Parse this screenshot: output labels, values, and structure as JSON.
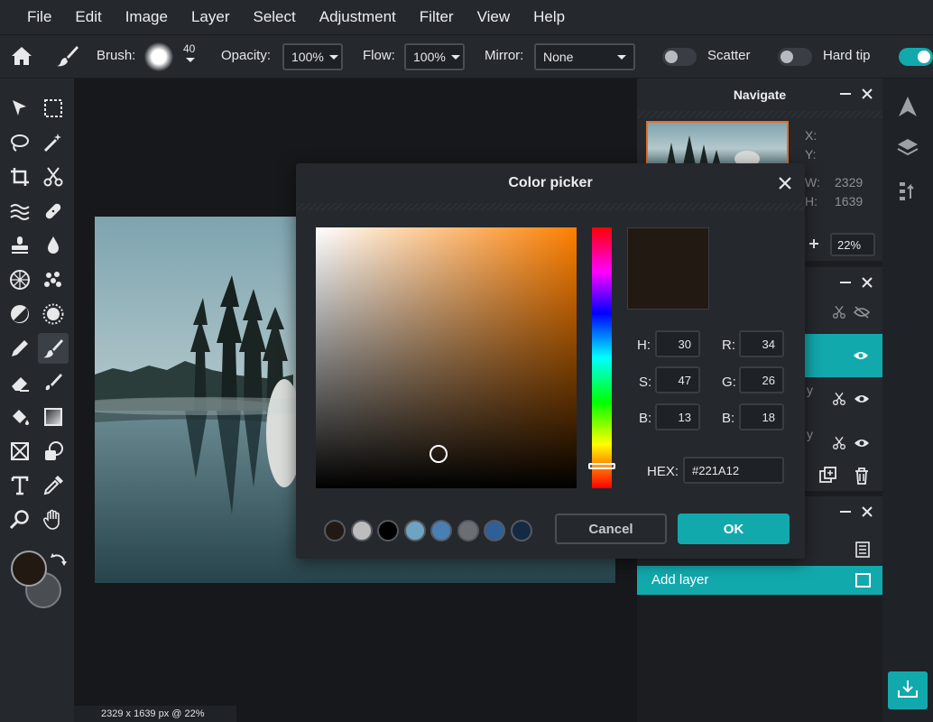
{
  "menu": [
    "File",
    "Edit",
    "Image",
    "Layer",
    "Select",
    "Adjustment",
    "Filter",
    "View",
    "Help"
  ],
  "options": {
    "brush_label": "Brush:",
    "brush_size": "40",
    "opacity_label": "Opacity:",
    "opacity_value": "100%",
    "flow_label": "Flow:",
    "flow_value": "100%",
    "mirror_label": "Mirror:",
    "mirror_value": "None",
    "scatter_label": "Scatter",
    "scatter_on": false,
    "hardtip_label": "Hard tip",
    "hardtip_on": false,
    "last_toggle_on": true
  },
  "tools": [
    "select-arrow",
    "marquee",
    "lasso",
    "magic-wand",
    "crop",
    "scissors",
    "liquify",
    "healing-bandage",
    "clone-stamp",
    "blur-drop",
    "sponge-dots",
    "dots-cluster",
    "dodge",
    "burn-sun",
    "pencil",
    "brush",
    "eraser",
    "smudge",
    "paint-bucket",
    "gradient",
    "frame-box",
    "shape",
    "text",
    "eyedropper",
    "zoom",
    "hand"
  ],
  "colors": {
    "primary": "#221A12",
    "secondary": "#4a4d52",
    "accent": "#12a9ad"
  },
  "canvas": {
    "status": "2329 x 1639 px @ 22%"
  },
  "navigate": {
    "title": "Navigate",
    "x_label": "X:",
    "y_label": "Y:",
    "w_label": "W:",
    "w_value": "2329",
    "h_label": "H:",
    "h_value": "1639",
    "zoom": "22%"
  },
  "layers": {
    "add_layer": "Add layer",
    "row_fragment": "y"
  },
  "picker": {
    "title": "Color picker",
    "h_label": "H:",
    "h": "30",
    "s_label": "S:",
    "s": "47",
    "b_label": "B:",
    "b": "13",
    "r_label": "R:",
    "r": "34",
    "g_label": "G:",
    "g": "26",
    "bb_label": "B:",
    "bb": "18",
    "hex_label": "HEX:",
    "hex": "#221A12",
    "saturation": 0.47,
    "brightness": 0.13,
    "hue": 30,
    "swatches": [
      "#221A12",
      "#bdbdbd",
      "#000000",
      "#6ea4c1",
      "#4a7fb5",
      "#6b6e72",
      "#2f5f96",
      "#142a44"
    ],
    "cancel_label": "Cancel",
    "ok_label": "OK"
  }
}
